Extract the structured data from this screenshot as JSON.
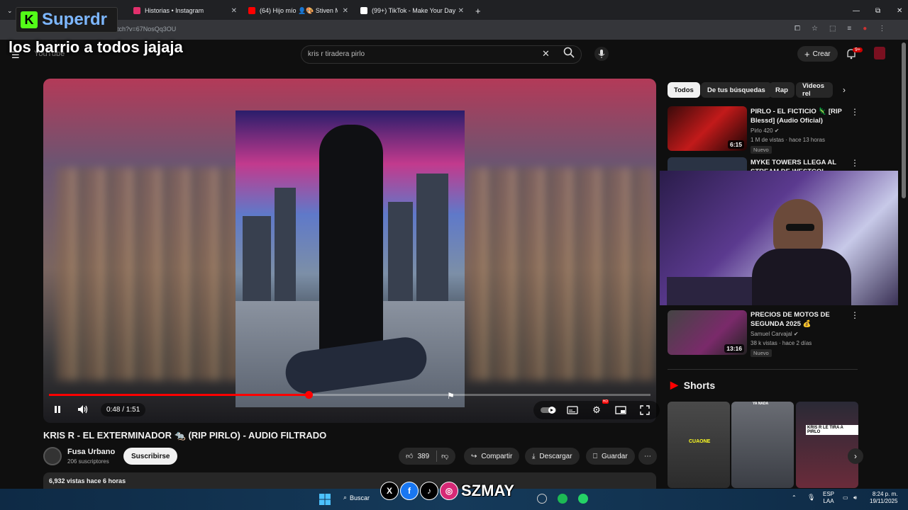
{
  "browser": {
    "tabs": [
      {
        "label": "Superdr",
        "color": "#53fc18"
      },
      {
        "label": "Historias • Instagram",
        "color": "#e1306c"
      },
      {
        "label": "(64) Hijo mío 👤🎨 Stiven Me...",
        "color": "#ff0000"
      },
      {
        "label": "(99+) TikTok - Make Your Day",
        "color": "#000000"
      }
    ],
    "url": "atch?v=67NosQq3OU"
  },
  "overlay": {
    "kick_logo": "K",
    "kick_name": "Superdr",
    "caption": "los barrio a todos jajaja",
    "socials": [
      "X",
      "f",
      "♪",
      "◎"
    ],
    "brand": "SZMAY"
  },
  "header": {
    "logo": "YouTube",
    "search_value": "kris r tiradera pirlo",
    "create_label": "Crear",
    "notif_badge": "9+"
  },
  "player": {
    "time": "0:48 / 1:51",
    "progress": 0.432
  },
  "video": {
    "title": "KRIS R - EL EXTERMINADOR 🐀 (RIP PIRLO) - AUDIO FILTRADO",
    "channel": "Fusa Urbano",
    "subscribers": "206 suscriptores",
    "subscribe_label": "Suscribirse",
    "likes": "389",
    "share_label": "Compartir",
    "download_label": "Descargar",
    "save_label": "Guardar",
    "stats": "6,932 vistas  hace 6 horas"
  },
  "sidebar": {
    "chips": [
      "Todos",
      "De tus búsquedas",
      "Rap",
      "Videos rel"
    ],
    "videos": [
      {
        "title": "PIRLO - EL FICTICIO 🦎 [RIP Blessd] (Audio Oficial)",
        "channel": "Pirlo 420 ✔",
        "meta": "1 M de vistas · hace 13 horas",
        "duration": "6:15",
        "badge": "Nuevo"
      },
      {
        "title": "MYKE TOWERS LLEGA AL STREAM DE WESTCOL",
        "channel": "",
        "meta": "",
        "duration": "",
        "badge": ""
      },
      {
        "title": "PRECIOS DE MOTOS DE SEGUNDA 2025 💰",
        "channel": "Samuel Carvajal ✔",
        "meta": "38 k vistas · hace 2 días",
        "duration": "13:16",
        "badge": "Nuevo"
      }
    ],
    "shorts_heading": "Shorts",
    "shorts": [
      {
        "caption": "CUAONE"
      },
      {
        "caption": "YA NADA"
      },
      {
        "caption": "KRIS R LE TIRA A PIRLO"
      }
    ]
  },
  "taskbar": {
    "search_label": "Buscar",
    "lang_top": "ESP",
    "lang_bottom": "LAA",
    "time": "8:24 p. m.",
    "date": "19/11/2025"
  }
}
